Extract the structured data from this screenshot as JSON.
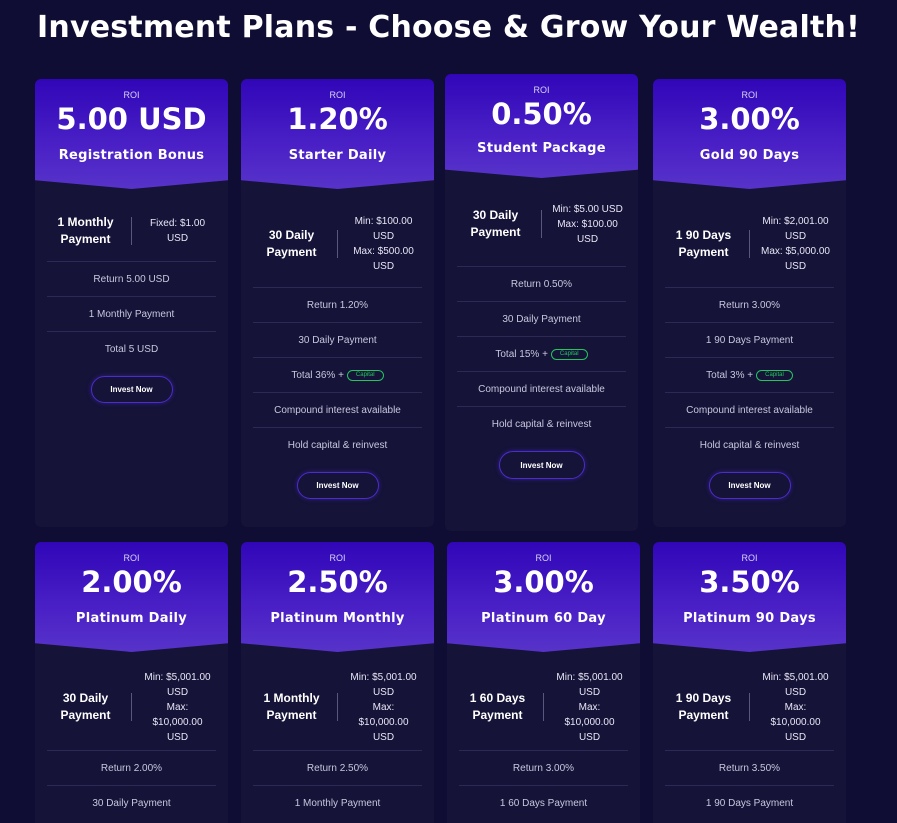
{
  "page": {
    "title": "Investment Plans - Choose & Grow Your Wealth!"
  },
  "cards": [
    {
      "roi_label": "ROI",
      "roi": "5.00 USD",
      "name": "Registration Bonus",
      "payment": "1 Monthly Payment",
      "amount_line1": "Fixed: $1.00 USD",
      "amount_line2": "",
      "features": [
        "Return 5.00 USD",
        "1 Monthly Payment",
        "Total 5 USD"
      ],
      "button": "Invest Now"
    },
    {
      "roi_label": "ROI",
      "roi": "1.20%",
      "name": "Starter Daily",
      "payment": "30 Daily Payment",
      "amount_line1": "Min: $100.00 USD",
      "amount_line2": "Max: $500.00 USD",
      "features": [
        "Return 1.20%",
        "30 Daily Payment",
        "Total 36% +",
        "Compound interest available",
        "Hold capital & reinvest"
      ],
      "badge": "Capital",
      "button": "Invest Now"
    },
    {
      "roi_label": "ROI",
      "roi": "0.50%",
      "name": "Student Package",
      "payment": "30 Daily Payment",
      "amount_line1": "Min: $5.00 USD",
      "amount_line2": "Max: $100.00 USD",
      "features": [
        "Return 0.50%",
        "30 Daily Payment",
        "Total 15% +",
        "Compound interest available",
        "Hold capital & reinvest"
      ],
      "badge": "Capital",
      "button": "Invest Now"
    },
    {
      "roi_label": "ROI",
      "roi": "3.00%",
      "name": "Gold 90 Days",
      "payment": "1 90 Days Payment",
      "amount_line1": "Min: $2,001.00 USD",
      "amount_line2": "Max: $5,000.00 USD",
      "features": [
        "Return 3.00%",
        "1 90 Days Payment",
        "Total 3% +",
        "Compound interest available",
        "Hold capital & reinvest"
      ],
      "badge": "Capital",
      "button": "Invest Now"
    },
    {
      "roi_label": "ROI",
      "roi": "2.00%",
      "name": "Platinum Daily",
      "payment": "30 Daily Payment",
      "amount_line1": "Min: $5,001.00 USD",
      "amount_line2": "Max: $10,000.00 USD",
      "features": [
        "Return 2.00%",
        "30 Daily Payment"
      ]
    },
    {
      "roi_label": "ROI",
      "roi": "2.50%",
      "name": "Platinum Monthly",
      "payment": "1 Monthly Payment",
      "amount_line1": "Min: $5,001.00 USD",
      "amount_line2": "Max: $10,000.00 USD",
      "features": [
        "Return 2.50%",
        "1 Monthly Payment"
      ]
    },
    {
      "roi_label": "ROI",
      "roi": "3.00%",
      "name": "Platinum 60 Day",
      "payment": "1 60 Days Payment",
      "amount_line1": "Min: $5,001.00 USD",
      "amount_line2": "Max: $10,000.00 USD",
      "features": [
        "Return 3.00%",
        "1 60 Days Payment"
      ]
    },
    {
      "roi_label": "ROI",
      "roi": "3.50%",
      "name": "Platinum 90 Days",
      "payment": "1 90 Days Payment",
      "amount_line1": "Min: $5,001.00 USD",
      "amount_line2": "Max: $10,000.00 USD",
      "features": [
        "Return 3.50%",
        "1 90 Days Payment"
      ]
    }
  ]
}
